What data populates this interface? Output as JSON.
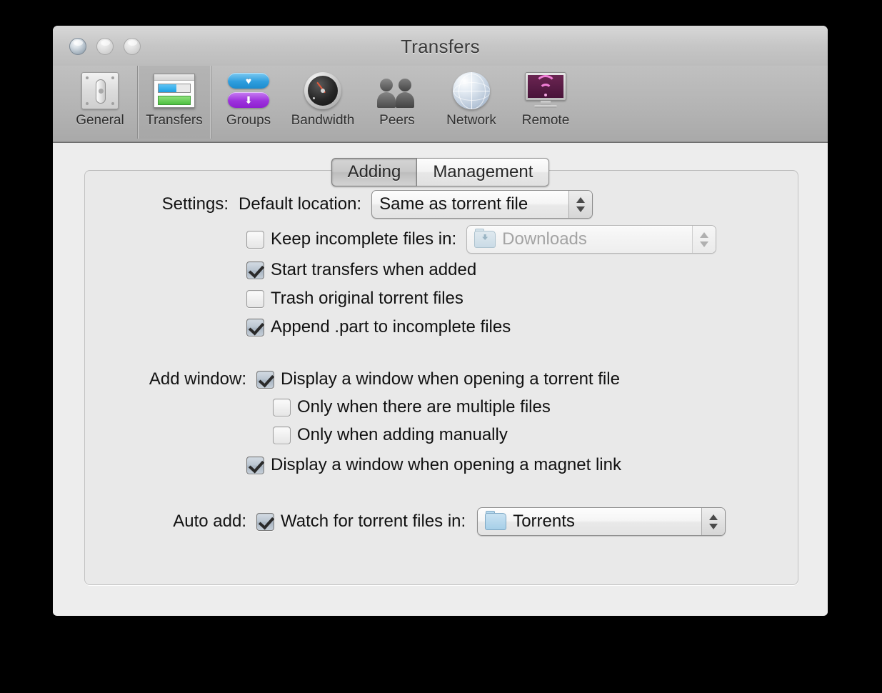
{
  "window": {
    "title": "Transfers",
    "traffic_lights": [
      "close-button",
      "minimize-button",
      "zoom-button"
    ]
  },
  "toolbar": {
    "items": [
      {
        "label": "General",
        "icon": "general-icon",
        "selected": false
      },
      {
        "label": "Transfers",
        "icon": "transfers-icon",
        "selected": true
      },
      {
        "label": "Groups",
        "icon": "groups-icon",
        "selected": false
      },
      {
        "label": "Bandwidth",
        "icon": "bandwidth-icon",
        "selected": false
      },
      {
        "label": "Peers",
        "icon": "peers-icon",
        "selected": false
      },
      {
        "label": "Network",
        "icon": "network-icon",
        "selected": false
      },
      {
        "label": "Remote",
        "icon": "remote-icon",
        "selected": false
      }
    ]
  },
  "tabs": [
    {
      "label": "Adding",
      "active": true
    },
    {
      "label": "Management",
      "active": false
    }
  ],
  "settings_section": {
    "label": "Settings:",
    "default_location": {
      "label": "Default location:",
      "value": "Same as torrent file",
      "enabled": true
    },
    "keep_incomplete": {
      "label": "Keep incomplete files in:",
      "checked": false,
      "popup_value": "Downloads",
      "popup_enabled": false,
      "popup_icon": "downloads-folder-icon"
    },
    "checkboxes": [
      {
        "label": "Start transfers when added",
        "checked": true
      },
      {
        "label": "Trash original torrent files",
        "checked": false
      },
      {
        "label": "Append .part to incomplete files",
        "checked": true
      }
    ]
  },
  "add_window_section": {
    "label": "Add window:",
    "checkboxes": [
      {
        "label": "Display a window when opening a torrent file",
        "checked": true,
        "indent": false
      },
      {
        "label": "Only when there are multiple files",
        "checked": false,
        "indent": true
      },
      {
        "label": "Only when adding manually",
        "checked": false,
        "indent": true
      },
      {
        "label": "Display a window when opening a magnet link",
        "checked": true,
        "indent": false
      }
    ]
  },
  "auto_add_section": {
    "label": "Auto add:",
    "checkbox": {
      "label": "Watch for torrent files in:",
      "checked": true
    },
    "popup_value": "Torrents",
    "popup_icon": "folder-icon",
    "highlighted": true
  },
  "colors": {
    "highlight_rect": "#fa6152",
    "window_bg": "#ececec",
    "toolbar_bg": "#b4b4b4",
    "pane_bg": "#e9e9e9",
    "accent_blue": "#1d9fe4",
    "accent_green": "#4ec040",
    "accent_purple": "#9d32dd"
  }
}
